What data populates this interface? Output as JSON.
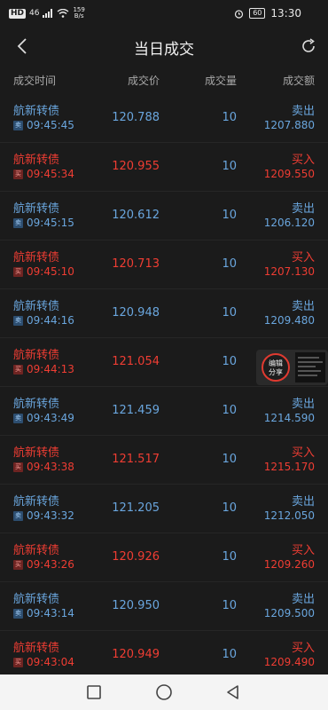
{
  "status": {
    "network": "HD",
    "signal": "46",
    "speed_value": "159",
    "speed_unit": "B/s",
    "battery": "60",
    "time": "13:30"
  },
  "header": {
    "title": "当日成交"
  },
  "columns": {
    "time": "成交时间",
    "price": "成交价",
    "qty": "成交量",
    "amount": "成交额"
  },
  "trades": [
    {
      "name": "航新转债",
      "badge": "卖",
      "time": "09:45:45",
      "price": "120.788",
      "qty": "10",
      "dir": "卖出",
      "amount": "1207.880",
      "side": "sell"
    },
    {
      "name": "航新转债",
      "badge": "买",
      "time": "09:45:34",
      "price": "120.955",
      "qty": "10",
      "dir": "买入",
      "amount": "1209.550",
      "side": "buy"
    },
    {
      "name": "航新转债",
      "badge": "卖",
      "time": "09:45:15",
      "price": "120.612",
      "qty": "10",
      "dir": "卖出",
      "amount": "1206.120",
      "side": "sell"
    },
    {
      "name": "航新转债",
      "badge": "买",
      "time": "09:45:10",
      "price": "120.713",
      "qty": "10",
      "dir": "买入",
      "amount": "1207.130",
      "side": "buy"
    },
    {
      "name": "航新转债",
      "badge": "卖",
      "time": "09:44:16",
      "price": "120.948",
      "qty": "10",
      "dir": "卖出",
      "amount": "1209.480",
      "side": "sell"
    },
    {
      "name": "航新转债",
      "badge": "买",
      "time": "09:44:13",
      "price": "121.054",
      "qty": "10",
      "dir": "",
      "amount": "",
      "side": "buy"
    },
    {
      "name": "航新转债",
      "badge": "卖",
      "time": "09:43:49",
      "price": "121.459",
      "qty": "10",
      "dir": "卖出",
      "amount": "1214.590",
      "side": "sell"
    },
    {
      "name": "航新转债",
      "badge": "买",
      "time": "09:43:38",
      "price": "121.517",
      "qty": "10",
      "dir": "买入",
      "amount": "1215.170",
      "side": "buy"
    },
    {
      "name": "航新转债",
      "badge": "卖",
      "time": "09:43:32",
      "price": "121.205",
      "qty": "10",
      "dir": "卖出",
      "amount": "1212.050",
      "side": "sell"
    },
    {
      "name": "航新转债",
      "badge": "买",
      "time": "09:43:26",
      "price": "120.926",
      "qty": "10",
      "dir": "买入",
      "amount": "1209.260",
      "side": "buy"
    },
    {
      "name": "航新转债",
      "badge": "卖",
      "time": "09:43:14",
      "price": "120.950",
      "qty": "10",
      "dir": "卖出",
      "amount": "1209.500",
      "side": "sell"
    },
    {
      "name": "航新转债",
      "badge": "买",
      "time": "09:43:04",
      "price": "120.949",
      "qty": "10",
      "dir": "买入",
      "amount": "1209.490",
      "side": "buy"
    }
  ],
  "float_share": {
    "label_line1": "编辑",
    "label_line2": "分享"
  },
  "colors": {
    "sell": "#6aa6de",
    "buy": "#ef3d33",
    "background": "#1b1b1b"
  }
}
